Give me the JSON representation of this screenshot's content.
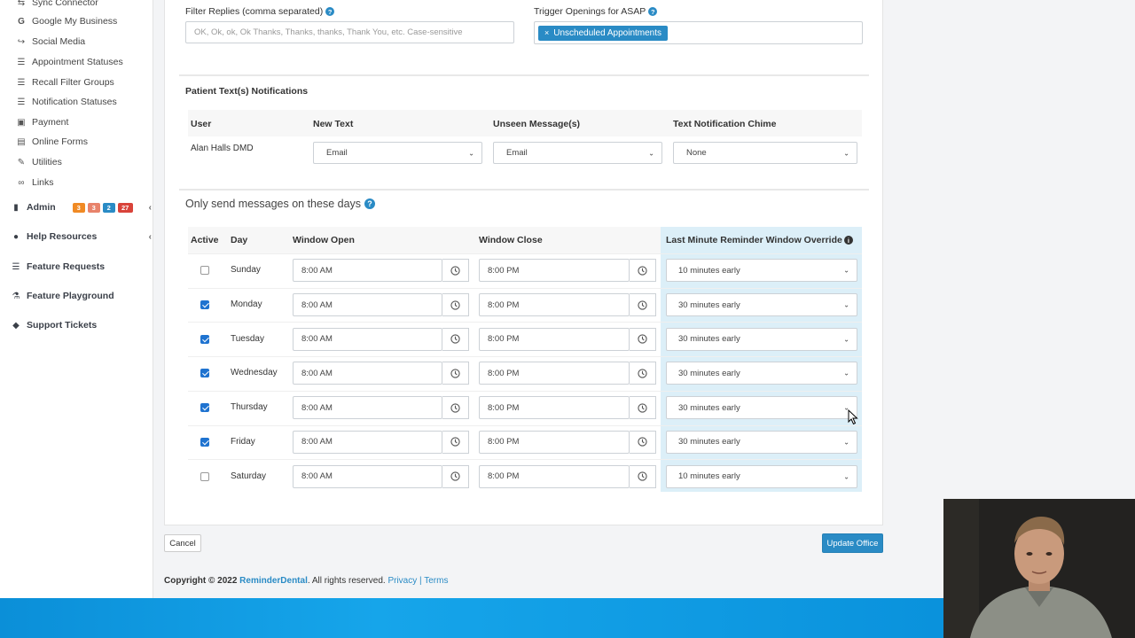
{
  "sidebar": {
    "items": [
      {
        "label": "Sync Connector",
        "icon": "sync-icon"
      },
      {
        "label": "Google My Business",
        "icon": "google-icon"
      },
      {
        "label": "Social Media",
        "icon": "share-icon"
      },
      {
        "label": "Appointment Statuses",
        "icon": "list-icon"
      },
      {
        "label": "Recall Filter Groups",
        "icon": "list-icon"
      },
      {
        "label": "Notification Statuses",
        "icon": "list-icon"
      },
      {
        "label": "Payment",
        "icon": "money-icon"
      },
      {
        "label": "Online Forms",
        "icon": "file-icon"
      },
      {
        "label": "Utilities",
        "icon": "wrench-icon"
      },
      {
        "label": "Links",
        "icon": "link-icon"
      }
    ],
    "admin": {
      "label": "Admin",
      "badges": [
        "3",
        "3",
        "2",
        "27"
      ],
      "badge_colors": [
        "#f08a24",
        "#e8836b",
        "#2a8bc5",
        "#d9433a"
      ]
    },
    "help_resources": "Help Resources",
    "feature_requests": "Feature Requests",
    "feature_playground": "Feature Playground",
    "support_tickets": "Support Tickets"
  },
  "filter_replies": {
    "label": "Filter Replies (comma separated)",
    "placeholder": "OK, Ok, ok, Ok Thanks, Thanks, thanks, Thank You, etc. Case-sensitive"
  },
  "trigger_openings": {
    "label": "Trigger Openings for ASAP",
    "tag": "Unscheduled Appointments"
  },
  "patient_notifications": {
    "title": "Patient Text(s) Notifications",
    "headers": {
      "user": "User",
      "new_text": "New Text",
      "unseen": "Unseen Message(s)",
      "chime": "Text Notification Chime"
    },
    "row": {
      "user": "Alan Halls DMD",
      "new_text": "Email",
      "unseen": "Email",
      "chime": "None"
    }
  },
  "schedule": {
    "title": "Only send messages on these days",
    "headers": {
      "active": "Active",
      "day": "Day",
      "open": "Window Open",
      "close": "Window Close",
      "override": "Last Minute Reminder Window Override"
    },
    "rows": [
      {
        "active": false,
        "day": "Sunday",
        "open": "8:00 AM",
        "close": "8:00 PM",
        "override": "10 minutes early"
      },
      {
        "active": true,
        "day": "Monday",
        "open": "8:00 AM",
        "close": "8:00 PM",
        "override": "30 minutes early"
      },
      {
        "active": true,
        "day": "Tuesday",
        "open": "8:00 AM",
        "close": "8:00 PM",
        "override": "30 minutes early"
      },
      {
        "active": true,
        "day": "Wednesday",
        "open": "8:00 AM",
        "close": "8:00 PM",
        "override": "30 minutes early"
      },
      {
        "active": true,
        "day": "Thursday",
        "open": "8:00 AM",
        "close": "8:00 PM",
        "override": "30 minutes early"
      },
      {
        "active": true,
        "day": "Friday",
        "open": "8:00 AM",
        "close": "8:00 PM",
        "override": "30 minutes early"
      },
      {
        "active": false,
        "day": "Saturday",
        "open": "8:00 AM",
        "close": "8:00 PM",
        "override": "10 minutes early"
      }
    ]
  },
  "buttons": {
    "cancel": "Cancel",
    "update": "Update Office"
  },
  "footer": {
    "copyright": "Copyright © 2022",
    "brand": "ReminderDental",
    "rights": ". All rights reserved.",
    "privacy": "Privacy",
    "sep": "|",
    "terms": "Terms"
  },
  "colors": {
    "accent": "#2a8bc5",
    "checkbox": "#1f73d0",
    "override_bg": "#dceff8"
  }
}
